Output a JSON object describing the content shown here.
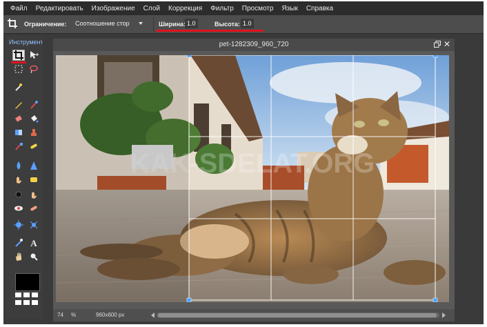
{
  "menu": [
    "Файл",
    "Редактировать",
    "Изображение",
    "Слой",
    "Коррекция",
    "Фильтр",
    "Просмотр",
    "Язык",
    "Справка"
  ],
  "options": {
    "constraint_label": "Ограничение:",
    "constraint_value": "Соотношение стор",
    "width_label": "Ширина:",
    "width_value": "1.0",
    "height_label": "Высота:",
    "height_value": "1.0"
  },
  "tools": {
    "title": "Инструменты",
    "items": [
      {
        "name": "crop-icon",
        "active": true
      },
      {
        "name": "move-icon"
      },
      {
        "name": "marquee-icon"
      },
      {
        "name": "lasso-icon"
      },
      {
        "name": "magic-wand-icon"
      },
      {
        "name": "pencil-icon"
      },
      {
        "name": "brush-icon"
      },
      {
        "name": "eraser-icon"
      },
      {
        "name": "paint-bucket-icon"
      },
      {
        "name": "gradient-icon"
      },
      {
        "name": "clone-stamp-icon"
      },
      {
        "name": "color-replace-icon"
      },
      {
        "name": "healing-icon"
      },
      {
        "name": "blur-icon"
      },
      {
        "name": "sharpen-icon"
      },
      {
        "name": "smudge-icon"
      },
      {
        "name": "sponge-icon"
      },
      {
        "name": "dodge-icon"
      },
      {
        "name": "burn-icon"
      },
      {
        "name": "red-eye-icon"
      },
      {
        "name": "spot-heal-icon"
      },
      {
        "name": "bloat-icon"
      },
      {
        "name": "pinch-icon"
      },
      {
        "name": "color-picker-icon"
      },
      {
        "name": "text-icon"
      },
      {
        "name": "hand-icon"
      },
      {
        "name": "zoom-icon"
      }
    ]
  },
  "canvas": {
    "title": "pet-1282309_960_720",
    "zoom": "74",
    "zoom_unit": "%",
    "dimensions": "960x600 px",
    "watermark": "KAK-SDELAT.ORG"
  },
  "colors": {
    "menubar": "#2c2c2c",
    "panel": "#3d3d3d",
    "accent_red": "#e0141e",
    "crop_handle": "#4aa3ff",
    "title_blue": "#8fc1ff"
  }
}
